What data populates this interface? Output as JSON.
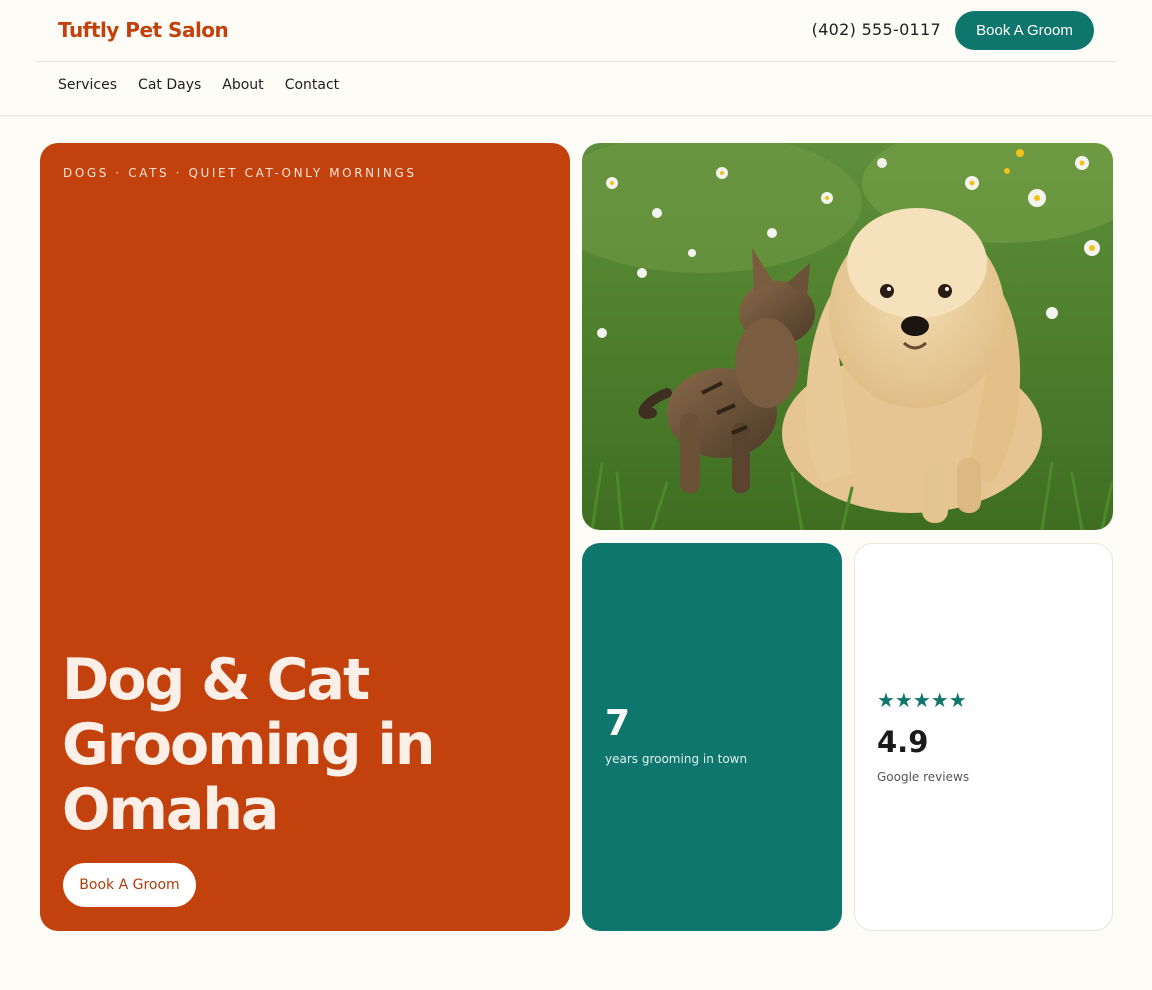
{
  "header": {
    "brand": "Tuftly Pet Salon",
    "phone": "(402) 555-0117",
    "cta_label": "Book A Groom"
  },
  "nav": {
    "items": [
      {
        "label": "Services"
      },
      {
        "label": "Cat Days"
      },
      {
        "label": "About"
      },
      {
        "label": "Contact"
      }
    ]
  },
  "hero": {
    "eyebrow": "DOGS · CATS · QUIET CAT-ONLY MORNINGS",
    "title": "Dog & Cat Grooming in Omaha",
    "cta_label": "Book A Groom"
  },
  "photo": {
    "alt": "Tabby cat and fluffy cream dog sitting in grass with daisies"
  },
  "stats": {
    "value": "7",
    "label": "years grooming in town"
  },
  "reviews": {
    "stars": "★★★★★",
    "rating": "4.9",
    "label": "Google reviews"
  },
  "colors": {
    "brand": "#c2410c",
    "accent": "#0e766c",
    "background": "#fefcf6"
  }
}
